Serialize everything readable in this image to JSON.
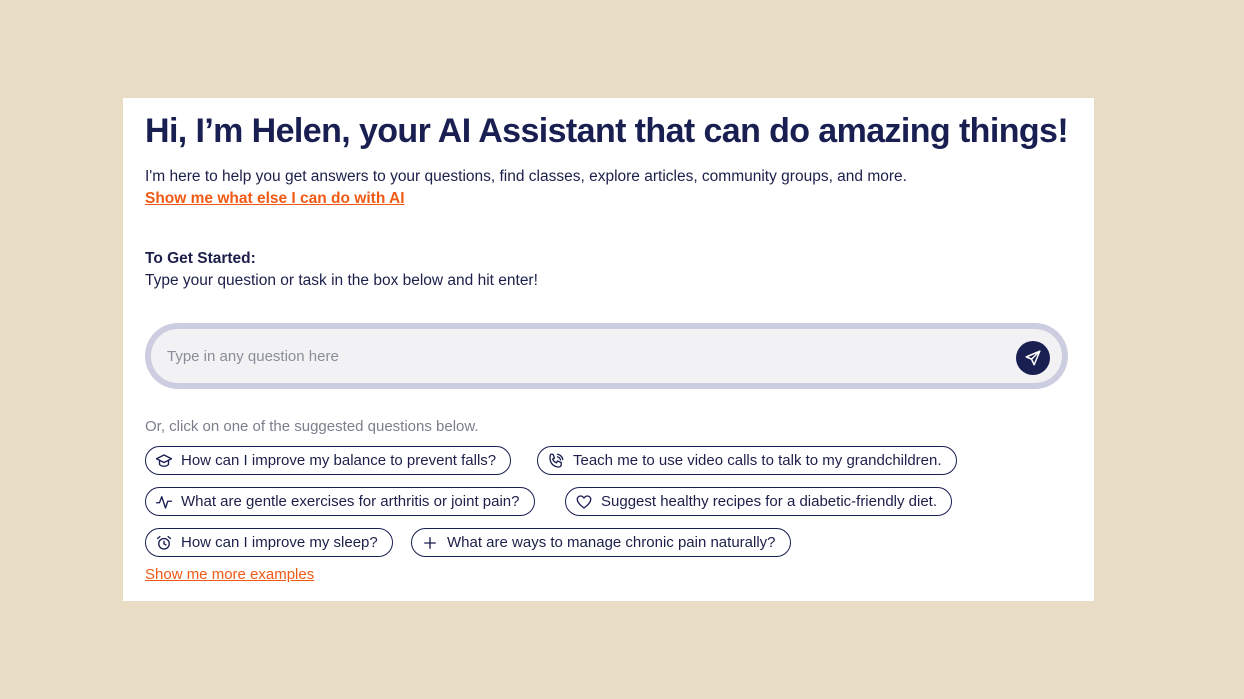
{
  "header": {
    "title": "Hi, I’m Helen, your AI Assistant that can do amazing things!",
    "intro": "I'm here to help you get answers to your questions, find classes, explore articles, community groups, and more.",
    "ai_link": "Show me what else I can do with AI"
  },
  "getting_started": {
    "heading": "To Get Started:",
    "text": "Type your question or task in the box below and hit enter!"
  },
  "search": {
    "placeholder": "Type in any question here",
    "value": "",
    "send_icon": "send-icon"
  },
  "suggestions": {
    "label": "Or, click on one of the suggested questions below.",
    "items": [
      {
        "icon": "graduation-cap-icon",
        "label": "How can I improve my balance to prevent falls?"
      },
      {
        "icon": "phone-icon",
        "label": "Teach me to use video calls to talk to my grandchildren."
      },
      {
        "icon": "pulse-icon",
        "label": "What are gentle exercises for arthritis or joint pain?"
      },
      {
        "icon": "heart-icon",
        "label": "Suggest healthy recipes for a diabetic-friendly diet."
      },
      {
        "icon": "alarm-clock-icon",
        "label": "How can I improve my sleep?"
      },
      {
        "icon": "plus-icon",
        "label": "What are ways to manage chronic pain naturally?"
      }
    ],
    "more_link": "Show me more examples"
  },
  "colors": {
    "background": "#e8dcc4",
    "card": "#ffffff",
    "navy": "#1a1f52",
    "accent": "#f05a14",
    "search_ring": "#cccde0",
    "search_fill": "#f2f2f4"
  }
}
